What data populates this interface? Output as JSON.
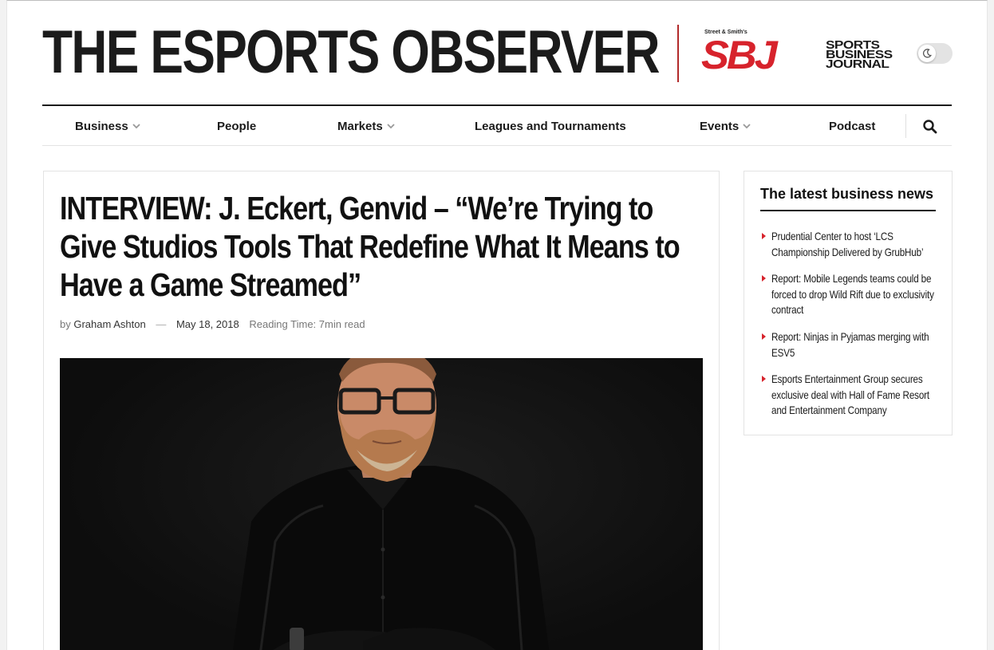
{
  "site": {
    "title": "THE ESPORTS OBSERVER",
    "partner_small": "Street & Smith's",
    "partner_letters": "SBJ",
    "partner_words": [
      "SPORTS",
      "BUSINESS",
      "JOURNAL"
    ]
  },
  "nav": {
    "items": [
      {
        "label": "Business",
        "has_dropdown": true
      },
      {
        "label": "People",
        "has_dropdown": false
      },
      {
        "label": "Markets",
        "has_dropdown": true
      },
      {
        "label": "Leagues and Tournaments",
        "has_dropdown": false
      },
      {
        "label": "Events",
        "has_dropdown": true
      },
      {
        "label": "Podcast",
        "has_dropdown": false
      }
    ],
    "search_icon": "search-icon"
  },
  "article": {
    "headline": "INTERVIEW: J. Eckert, Genvid – “We’re Trying to Give Studios Tools That Redefine What It Means to Have a Game Streamed”",
    "by_prefix": "by",
    "author": "Graham Ashton",
    "separator": "—",
    "date": "May 18, 2018",
    "reading_time": "Reading Time: 7min read"
  },
  "sidebar": {
    "title": "The latest business news",
    "items": [
      "Prudential Center to host ‘LCS Championship Delivered by GrubHub’",
      "Report: Mobile Legends teams could be forced to drop Wild Rift due to exclusivity contract",
      "Report: Ninjas in Pyjamas merging with ESV5",
      "Esports Entertainment Group secures exclusive deal with Hall of Fame Resort and Entertainment Company"
    ]
  },
  "colors": {
    "accent_red": "#d7232c",
    "text_dark": "#111111",
    "background": "#f2f2f2"
  }
}
